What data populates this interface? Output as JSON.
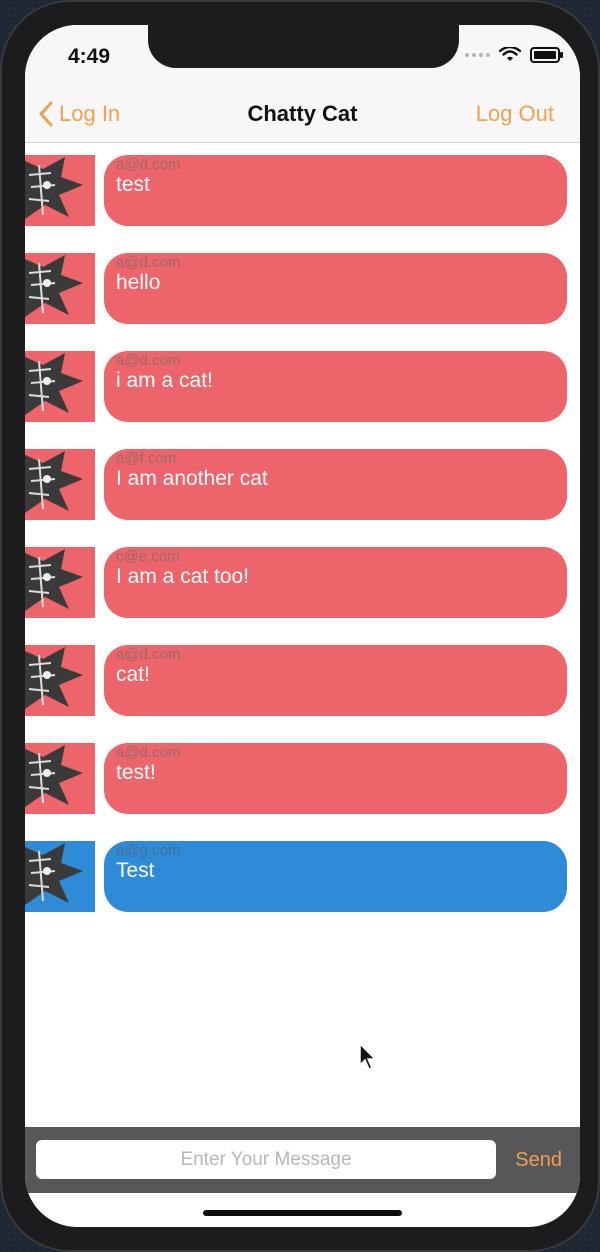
{
  "status_bar": {
    "time": "4:49"
  },
  "nav": {
    "back_label": "Log In",
    "title": "Chatty Cat",
    "logout_label": "Log Out"
  },
  "messages": [
    {
      "sender": "a@d.com",
      "text": "test"
    },
    {
      "sender": "a@d.com",
      "text": "hello"
    },
    {
      "sender": "a@d.com",
      "text": "i am a cat!"
    },
    {
      "sender": "a@f.com",
      "text": "I am another cat"
    },
    {
      "sender": "c@e.com",
      "text": "I am a cat too!"
    },
    {
      "sender": "a@d.com",
      "text": "cat!"
    },
    {
      "sender": "a@d.com",
      "text": "test!"
    },
    {
      "sender": "a@g.com",
      "text": "Test"
    }
  ],
  "composer": {
    "placeholder": "Enter Your Message",
    "send_label": "Send"
  },
  "colors": {
    "accent": "#f0a050",
    "bubble_other": "#ee646b",
    "bubble_self": "#2d8bd8"
  },
  "icons": {
    "back": "chevron-left-icon",
    "avatar": "cat-avatar-icon"
  }
}
